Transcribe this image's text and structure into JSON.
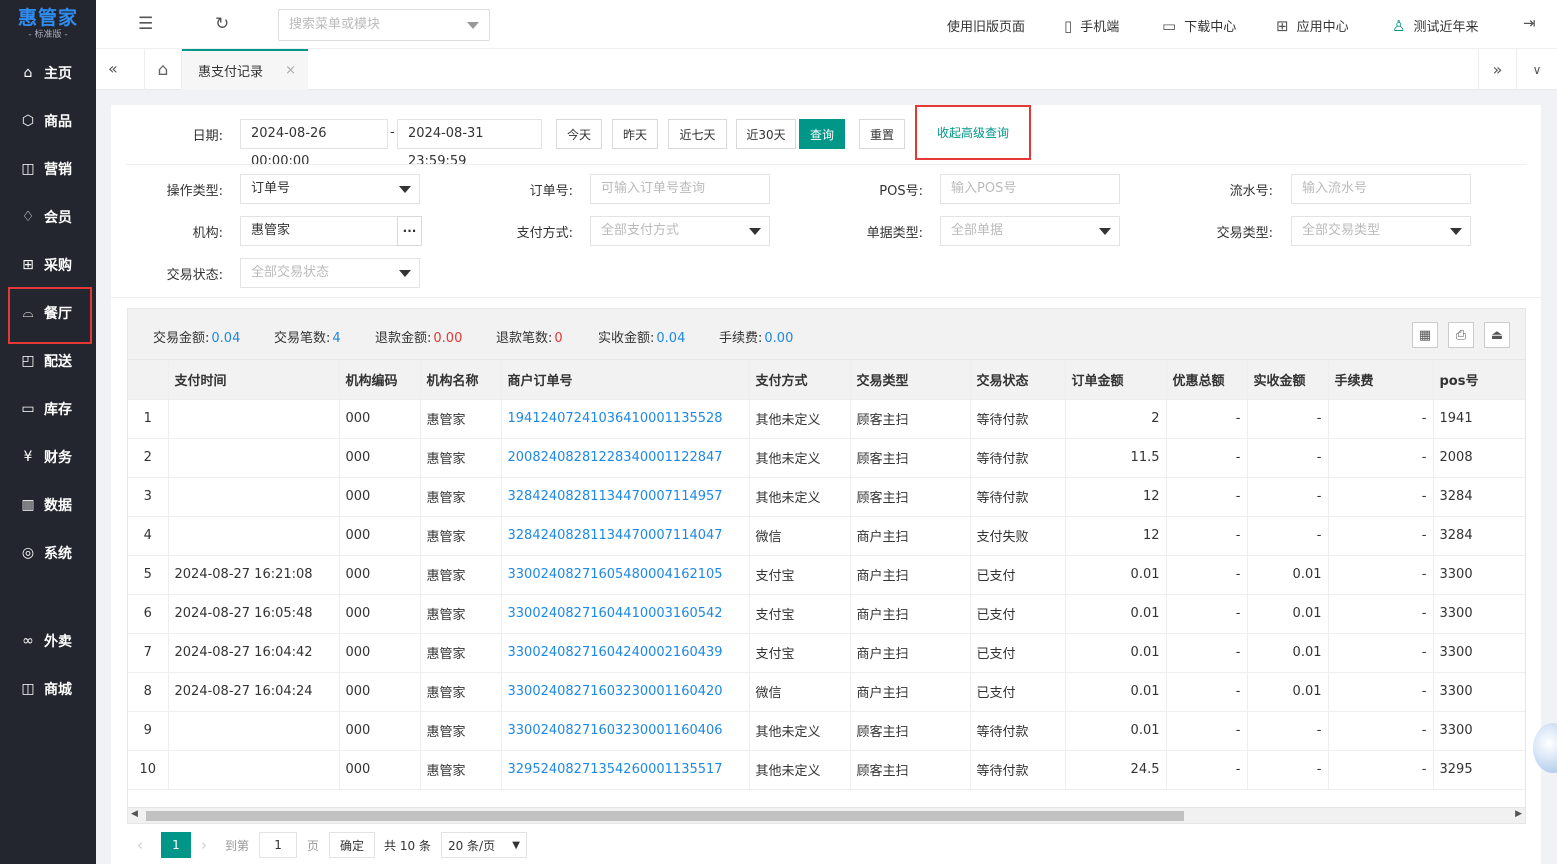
{
  "sidebar": {
    "logo": "惠管家",
    "logo_sub": "- 标准版 -",
    "items": [
      {
        "label": "主页",
        "icon": "home-icon",
        "glyph": "⌂"
      },
      {
        "label": "商品",
        "icon": "box-icon",
        "glyph": "⬡"
      },
      {
        "label": "营销",
        "icon": "chart-icon",
        "glyph": "◫"
      },
      {
        "label": "会员",
        "icon": "diamond-icon",
        "glyph": "♢"
      },
      {
        "label": "采购",
        "icon": "cart-icon",
        "glyph": "⊞"
      },
      {
        "label": "餐厅",
        "icon": "cloche-icon",
        "glyph": "⌓"
      },
      {
        "label": "配送",
        "icon": "truck-icon",
        "glyph": "◰"
      },
      {
        "label": "库存",
        "icon": "warehouse-icon",
        "glyph": "▭"
      },
      {
        "label": "财务",
        "icon": "yen-icon",
        "glyph": "¥"
      },
      {
        "label": "数据",
        "icon": "bar-chart-icon",
        "glyph": "▥"
      },
      {
        "label": "系统",
        "icon": "settings-icon",
        "glyph": "◎"
      },
      {
        "label": "外卖",
        "icon": "delivery-icon",
        "glyph": "∞"
      },
      {
        "label": "商城",
        "icon": "store-icon",
        "glyph": "◫"
      }
    ]
  },
  "topbar": {
    "search_placeholder": "搜索菜单或模块",
    "old_page": "使用旧版页面",
    "mobile": "手机端",
    "download": "下载中心",
    "apps": "应用中心",
    "user": "测试近年来"
  },
  "tabs": {
    "active": "惠支付记录",
    "close": "×"
  },
  "filters": {
    "date_label": "日期:",
    "date_start": "2024-08-26 00:00:00",
    "date_sep": "-",
    "date_end": "2024-08-31 23:59:59",
    "btn_today": "今天",
    "btn_yesterday": "昨天",
    "btn_7days": "近七天",
    "btn_30days": "近30天",
    "btn_query": "查询",
    "btn_reset": "重置",
    "advanced_toggle": "收起高级查询",
    "op_type_label": "操作类型:",
    "op_type_value": "订单号",
    "order_no_label": "订单号:",
    "order_no_placeholder": "可输入订单号查询",
    "pos_label": "POS号:",
    "pos_placeholder": "输入POS号",
    "serial_label": "流水号:",
    "serial_placeholder": "输入流水号",
    "org_label": "机构:",
    "org_value": "惠管家",
    "org_more": "···",
    "pay_method_label": "支付方式:",
    "pay_method_value": "全部支付方式",
    "doc_type_label": "单据类型:",
    "doc_type_value": "全部单据",
    "trade_type_label": "交易类型:",
    "trade_type_value": "全部交易类型",
    "trade_status_label": "交易状态:",
    "trade_status_value": "全部交易状态"
  },
  "stats": {
    "amount_label": "交易金额:",
    "amount": "0.04",
    "count_label": "交易笔数:",
    "count": "4",
    "refund_amount_label": "退款金额:",
    "refund_amount": "0.00",
    "refund_count_label": "退款笔数:",
    "refund_count": "0",
    "received_label": "实收金额:",
    "received": "0.04",
    "fee_label": "手续费:",
    "fee": "0.00"
  },
  "table": {
    "columns": [
      "",
      "支付时间",
      "机构编码",
      "机构名称",
      "商户订单号",
      "支付方式",
      "交易类型",
      "交易状态",
      "订单金额",
      "优惠总额",
      "实收金额",
      "手续费",
      "pos号"
    ],
    "rows": [
      [
        "1",
        "",
        "000",
        "惠管家",
        "19412407241036410001135528",
        "其他未定义",
        "顾客主扫",
        "等待付款",
        "2",
        "-",
        "-",
        "-",
        "1941"
      ],
      [
        "2",
        "",
        "000",
        "惠管家",
        "20082408281228340001122847",
        "其他未定义",
        "顾客主扫",
        "等待付款",
        "11.5",
        "-",
        "-",
        "-",
        "2008"
      ],
      [
        "3",
        "",
        "000",
        "惠管家",
        "32842408281134470007114957",
        "其他未定义",
        "顾客主扫",
        "等待付款",
        "12",
        "-",
        "-",
        "-",
        "3284"
      ],
      [
        "4",
        "",
        "000",
        "惠管家",
        "32842408281134470007114047",
        "微信",
        "商户主扫",
        "支付失败",
        "12",
        "-",
        "-",
        "-",
        "3284"
      ],
      [
        "5",
        "2024-08-27 16:21:08",
        "000",
        "惠管家",
        "33002408271605480004162105",
        "支付宝",
        "商户主扫",
        "已支付",
        "0.01",
        "-",
        "0.01",
        "-",
        "3300"
      ],
      [
        "6",
        "2024-08-27 16:05:48",
        "000",
        "惠管家",
        "33002408271604410003160542",
        "支付宝",
        "商户主扫",
        "已支付",
        "0.01",
        "-",
        "0.01",
        "-",
        "3300"
      ],
      [
        "7",
        "2024-08-27 16:04:42",
        "000",
        "惠管家",
        "33002408271604240002160439",
        "支付宝",
        "商户主扫",
        "已支付",
        "0.01",
        "-",
        "0.01",
        "-",
        "3300"
      ],
      [
        "8",
        "2024-08-27 16:04:24",
        "000",
        "惠管家",
        "33002408271603230001160420",
        "微信",
        "商户主扫",
        "已支付",
        "0.01",
        "-",
        "0.01",
        "-",
        "3300"
      ],
      [
        "9",
        "",
        "000",
        "惠管家",
        "33002408271603230001160406",
        "其他未定义",
        "顾客主扫",
        "等待付款",
        "0.01",
        "-",
        "-",
        "-",
        "3300"
      ],
      [
        "10",
        "",
        "000",
        "惠管家",
        "32952408271354260001135517",
        "其他未定义",
        "顾客主扫",
        "等待付款",
        "24.5",
        "-",
        "-",
        "-",
        "3295"
      ]
    ]
  },
  "pager": {
    "current": "1",
    "goto_label": "到第",
    "goto_value": "1",
    "page_unit": "页",
    "confirm": "确定",
    "total": "共 10 条",
    "page_size": "20 条/页"
  },
  "colors": {
    "sidebar_bg": "#23262e",
    "accent": "#009688",
    "link": "#1e88e5",
    "highlight": "#e53935"
  }
}
